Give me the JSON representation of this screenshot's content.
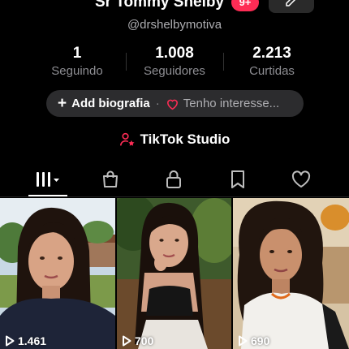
{
  "profile": {
    "display_name": "Sr Tommy Shelby",
    "notification_badge": "9+",
    "handle": "@drshelbymotiva"
  },
  "stats": [
    {
      "value": "1",
      "label": "Seguindo"
    },
    {
      "value": "1.008",
      "label": "Seguidores"
    },
    {
      "value": "2.213",
      "label": "Curtidas"
    }
  ],
  "bio": {
    "add_label": "Add biografia",
    "separator": "·",
    "interests_label": "Tenho interesse..."
  },
  "studio": {
    "label": "TikTok Studio"
  },
  "tabs": [
    {
      "name": "videos-grid",
      "icon": "grid-icon",
      "active": true
    },
    {
      "name": "shop",
      "icon": "shopping-bag-icon",
      "active": false
    },
    {
      "name": "private",
      "icon": "lock-icon",
      "active": false
    },
    {
      "name": "favorites",
      "icon": "bookmark-icon",
      "active": false
    },
    {
      "name": "liked",
      "icon": "heart-icon",
      "active": false
    }
  ],
  "videos": [
    {
      "views": "1.461"
    },
    {
      "views": "700"
    },
    {
      "views": "690"
    }
  ],
  "colors": {
    "background": "#000000",
    "accent": "#fe2c55",
    "pill_background": "#2c2c2e",
    "muted_text": "#8e8e93"
  }
}
